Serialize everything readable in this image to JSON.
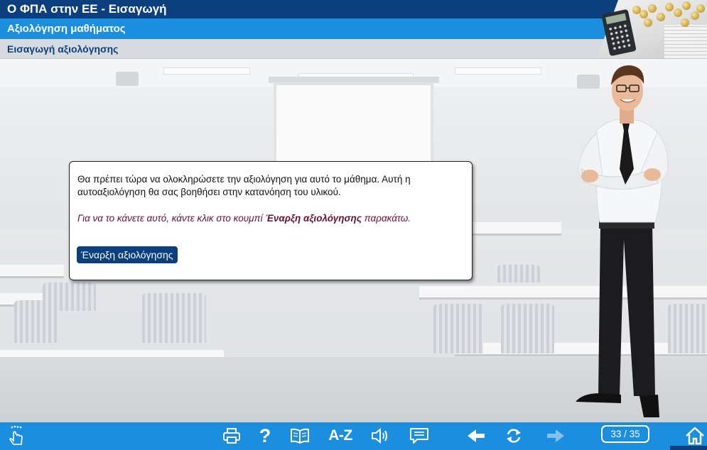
{
  "header": {
    "course_title": "Ο ΦΠΑ στην ΕΕ - Εισαγωγή",
    "section_title": "Αξιολόγηση μαθήματος",
    "page_title": "Εισαγωγή αξιολόγησης"
  },
  "dialog": {
    "intro_text": "Θα πρέπει τώρα να ολοκληρώσετε την αξιολόγηση για αυτό το μάθημα. Αυτή η αυτοαξιολόγηση θα σας βοηθήσει στην κατανόηση του υλικού.",
    "instruction_prefix": "Για να το κάνετε αυτό, κάντε κλικ στο κουμπί ",
    "instruction_emphasis": "Έναρξη αξιολόγησης",
    "instruction_suffix": " παρακάτω.",
    "start_button_label": "Έναρξη αξιολόγησης"
  },
  "toolbar": {
    "glossary_label": "A-Z",
    "help_label": "?",
    "page_counter": "33 / 35",
    "icons": [
      "touch-hand-icon",
      "print-icon",
      "help-icon",
      "book-icon",
      "glossary-icon",
      "audio-icon",
      "transcript-icon",
      "back-arrow-icon",
      "replay-icon",
      "forward-arrow-icon",
      "home-icon"
    ]
  },
  "colors": {
    "dark_blue": "#0b3f7d",
    "light_blue": "#1b8ee0",
    "instruction_text": "#6b0f35"
  }
}
